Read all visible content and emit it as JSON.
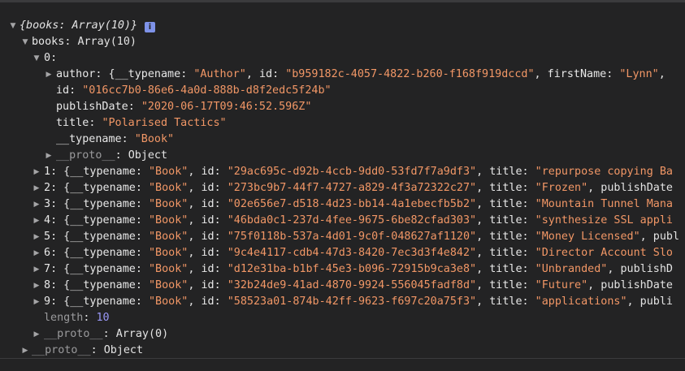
{
  "root": {
    "summary": "{books: Array(10)}",
    "info_glyph": "i"
  },
  "books_node": {
    "key": "books",
    "type": "Array(10)"
  },
  "item0": {
    "index": "0",
    "author_key": "author",
    "author_preview_open": "{",
    "author_typename_key": "__typename",
    "author_typename_val": "\"Author\"",
    "author_id_key": "id",
    "author_id_val": "\"b959182c-4057-4822-b260-f168f919dccd\"",
    "author_firstname_key": "firstName",
    "author_firstname_val": "\"Lynn\"",
    "id_key": "id",
    "id_val": "\"016cc7b0-86e6-4a0d-888b-d8f2edc5f24b\"",
    "publishDate_key": "publishDate",
    "publishDate_val": "\"2020-06-17T09:46:52.596Z\"",
    "title_key": "title",
    "title_val": "\"Polarised Tactics\"",
    "typename_key": "__typename",
    "typename_val": "\"Book\"",
    "proto_key": "__proto__",
    "proto_val": "Object"
  },
  "rows": [
    {
      "index": "1",
      "typename": "\"Book\"",
      "id": "\"29ac695c-d92b-4ccb-9dd0-53fd7f7a9df3\"",
      "title": "\"repurpose copying Ba",
      "next": ""
    },
    {
      "index": "2",
      "typename": "\"Book\"",
      "id": "\"273bc9b7-44f7-4727-a829-4f3a72322c27\"",
      "title": "\"Frozen\"",
      "next": ", publishDate"
    },
    {
      "index": "3",
      "typename": "\"Book\"",
      "id": "\"02e656e7-d518-4d23-bb14-4a1ebecfb5b2\"",
      "title": "\"Mountain Tunnel Mana",
      "next": ""
    },
    {
      "index": "4",
      "typename": "\"Book\"",
      "id": "\"46bda0c1-237d-4fee-9675-6be82cfad303\"",
      "title": "\"synthesize SSL appli",
      "next": ""
    },
    {
      "index": "5",
      "typename": "\"Book\"",
      "id": "\"75f0118b-537a-4d01-9c0f-048627af1120\"",
      "title": "\"Money Licensed\"",
      "next": ", publ"
    },
    {
      "index": "6",
      "typename": "\"Book\"",
      "id": "\"9c4e4117-cdb4-47d3-8420-7ec3d3f4e842\"",
      "title": "\"Director Account Slo",
      "next": ""
    },
    {
      "index": "7",
      "typename": "\"Book\"",
      "id": "\"d12e31ba-b1bf-45e3-b096-72915b9ca3e8\"",
      "title": "\"Unbranded\"",
      "next": ", publishD"
    },
    {
      "index": "8",
      "typename": "\"Book\"",
      "id": "\"32b24de9-41ad-4870-9924-556045fadf8d\"",
      "title": "\"Future\"",
      "next": ", publishDate"
    },
    {
      "index": "9",
      "typename": "\"Book\"",
      "id": "\"58523a01-874b-42ff-9623-f697c20a75f3\"",
      "title": "\"applications\"",
      "next": ", publi"
    }
  ],
  "length_row": {
    "key": "length",
    "value": "10"
  },
  "books_proto": {
    "key": "__proto__",
    "value": "Array(0)"
  },
  "root_proto": {
    "key": "__proto__",
    "value": "Object"
  },
  "glyphs": {
    "expanded": "▼",
    "collapsed": "▶"
  },
  "colors": {
    "background": "#232324",
    "string": "#f29766",
    "number": "#9a98f7",
    "badge": "#7e92e8"
  }
}
